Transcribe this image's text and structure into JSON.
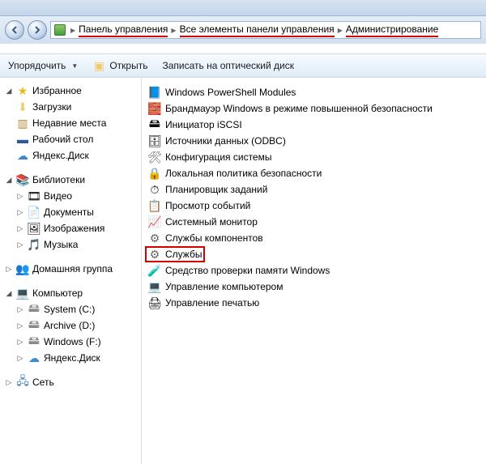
{
  "breadcrumb": {
    "seg1": "Панель управления",
    "seg2": "Все элементы панели управления",
    "seg3": "Администрирование"
  },
  "toolbar": {
    "organize": "Упорядочить",
    "open": "Открыть",
    "burn": "Записать на оптический диск"
  },
  "sidebar": {
    "favorites": {
      "label": "Избранное",
      "items": [
        "Загрузки",
        "Недавние места",
        "Рабочий стол",
        "Яндекс.Диск"
      ]
    },
    "libraries": {
      "label": "Библиотеки",
      "items": [
        "Видео",
        "Документы",
        "Изображения",
        "Музыка"
      ]
    },
    "homegroup": {
      "label": "Домашняя группа"
    },
    "computer": {
      "label": "Компьютер",
      "items": [
        "System (C:)",
        "Archive (D:)",
        "Windows (F:)",
        "Яндекс.Диск"
      ]
    },
    "network": {
      "label": "Сеть"
    }
  },
  "items": [
    "Windows PowerShell Modules",
    "Брандмауэр Windows в режиме повышенной безопасности",
    "Инициатор iSCSI",
    "Источники данных (ODBC)",
    "Конфигурация системы",
    "Локальная политика безопасности",
    "Планировщик заданий",
    "Просмотр событий",
    "Системный монитор",
    "Службы компонентов",
    "Службы",
    "Средство проверки памяти Windows",
    "Управление компьютером",
    "Управление печатью"
  ],
  "highlighted_index": 10
}
